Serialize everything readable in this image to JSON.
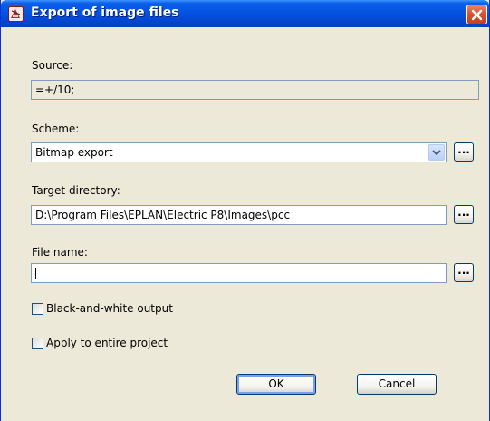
{
  "window": {
    "title": "Export of image files",
    "app_icon": "eplan-app-icon",
    "close_icon": "close-icon"
  },
  "source": {
    "label": "Source:",
    "value": "=+/10;"
  },
  "scheme": {
    "label": "Scheme:",
    "value": "Bitmap export",
    "dropdown_icon": "chevron-down-icon",
    "browse_label": "..."
  },
  "target_directory": {
    "label": "Target directory:",
    "value": "D:\\Program Files\\EPLAN\\Electric P8\\Images\\pcc",
    "browse_label": "..."
  },
  "file_name": {
    "label": "File name:",
    "value": "",
    "browse_label": "..."
  },
  "options": {
    "black_and_white": {
      "label": "Black-and-white output",
      "checked": false
    },
    "entire_project": {
      "label": "Apply to entire project",
      "checked": false
    }
  },
  "buttons": {
    "ok": "OK",
    "cancel": "Cancel"
  }
}
